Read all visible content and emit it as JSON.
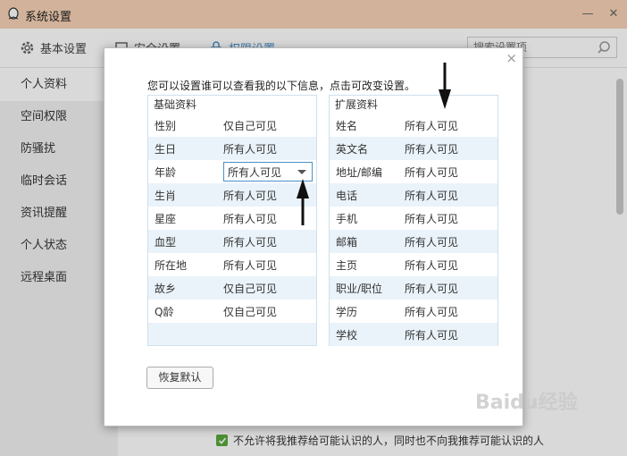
{
  "window": {
    "title": "系统设置",
    "minimize_glyph": "—",
    "close_glyph": "✕"
  },
  "toolbar": {
    "tabs": [
      {
        "label": "基本设置",
        "icon": "gear-icon"
      },
      {
        "label": "安全设置",
        "icon": "shield-icon"
      },
      {
        "label": "权限设置",
        "icon": "lock-icon"
      }
    ],
    "search_placeholder": "搜索设置项"
  },
  "sidebar": {
    "items": [
      {
        "label": "个人资料"
      },
      {
        "label": "空间权限"
      },
      {
        "label": "防骚扰"
      },
      {
        "label": "临时会话"
      },
      {
        "label": "资讯提醒"
      },
      {
        "label": "个人状态"
      },
      {
        "label": "远程桌面"
      }
    ]
  },
  "bottom_note": "不允许将我推荐给可能认识的人，同时也不向我推荐可能认识的人",
  "dialog": {
    "close_glyph": "×",
    "intro": "您可以设置谁可以查看我的以下信息，点击可改变设置。",
    "basic": {
      "header": "基础资料",
      "rows": [
        {
          "label": "性别",
          "value": "仅自己可见"
        },
        {
          "label": "生日",
          "value": "所有人可见"
        },
        {
          "label": "年龄",
          "value": "所有人可见"
        },
        {
          "label": "生肖",
          "value": "所有人可见"
        },
        {
          "label": "星座",
          "value": "所有人可见"
        },
        {
          "label": "血型",
          "value": "所有人可见"
        },
        {
          "label": "所在地",
          "value": "所有人可见"
        },
        {
          "label": "故乡",
          "value": "仅自己可见"
        },
        {
          "label": "Q龄",
          "value": "仅自己可见"
        }
      ]
    },
    "extended": {
      "header": "扩展资料",
      "rows": [
        {
          "label": "姓名",
          "value": "所有人可见"
        },
        {
          "label": "英文名",
          "value": "所有人可见"
        },
        {
          "label": "地址/邮编",
          "value": "所有人可见"
        },
        {
          "label": "电话",
          "value": "所有人可见"
        },
        {
          "label": "手机",
          "value": "所有人可见"
        },
        {
          "label": "邮箱",
          "value": "所有人可见"
        },
        {
          "label": "主页",
          "value": "所有人可见"
        },
        {
          "label": "职业/职位",
          "value": "所有人可见"
        },
        {
          "label": "学历",
          "value": "所有人可见"
        },
        {
          "label": "学校",
          "value": "所有人可见"
        }
      ]
    },
    "restore_label": "恢复默认"
  },
  "watermark": "Baidu经验",
  "colors": {
    "titlebar": "#f7d2b6",
    "accent": "#4a90c8",
    "panel_tint": "#eaf3fa",
    "check": "#5aa83c"
  }
}
